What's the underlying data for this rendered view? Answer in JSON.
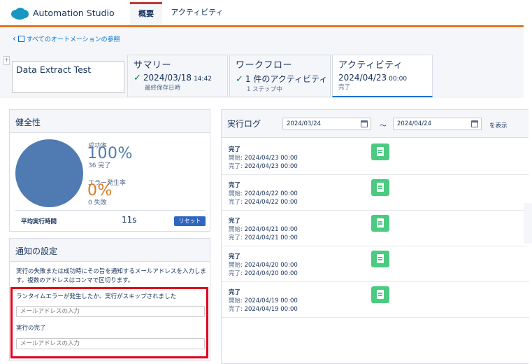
{
  "app": {
    "title": "Automation Studio"
  },
  "tabs": [
    {
      "label": "概要"
    },
    {
      "label": "アクティビティ"
    }
  ],
  "breadcrumb": {
    "label": "すべてのオートメーションの参照"
  },
  "automation": {
    "name": "Data Extract Test"
  },
  "summary_cards": {
    "summary": {
      "title": "サマリー",
      "date": "2024/03/18",
      "time": "14:42",
      "sub": "最終保存日時"
    },
    "workflow": {
      "title": "ワークフロー",
      "main": "1 件のアクティビティ",
      "sub": "1 ステップ中"
    },
    "activity": {
      "title": "アクティビティ",
      "date": "2024/04/23",
      "time": "00:00",
      "sub": "完了"
    }
  },
  "health": {
    "title": "健全性",
    "success_label": "成功率",
    "success_value": "100%",
    "success_count": "36 完了",
    "error_label": "エラー発生率",
    "error_value": "0%",
    "error_count": "0 失敗",
    "success_fraction": 1.0,
    "avg_label": "平均実行時間",
    "avg_value": "11s",
    "reset_label": "リセット"
  },
  "notify": {
    "title": "通知の設定",
    "description": "実行の失敗または成功時にその旨を通知するメールアドレスを入力します。複数のアドレスはコンマで区切ります。",
    "error_label": "ランタイムエラーが発生したか、実行がスキップされました",
    "error_placeholder": "メールアドレスの入力",
    "complete_label": "実行の完了",
    "complete_placeholder": "メールアドレスの入力"
  },
  "runlog": {
    "title": "実行ログ",
    "from_date": "2024/03/24",
    "to_date": "2024/04/24",
    "tilde": "～",
    "show_label": "を表示",
    "start_key": "開始:",
    "end_key": "完了:",
    "entries": [
      {
        "status": "完了",
        "start": "2024/04/23 00:00",
        "end": "2024/04/23 00:00"
      },
      {
        "status": "完了",
        "start": "2024/04/22 00:00",
        "end": "2024/04/22 00:00"
      },
      {
        "status": "完了",
        "start": "2024/04/21 00:00",
        "end": "2024/04/21 00:00"
      },
      {
        "status": "完了",
        "start": "2024/04/20 00:00",
        "end": "2024/04/20 00:00"
      },
      {
        "status": "完了",
        "start": "2024/04/19 00:00",
        "end": "2024/04/19 00:00"
      }
    ]
  },
  "colors": {
    "accent": "#e1781e",
    "brand_blue": "#0070d2",
    "success_green": "#4bca81",
    "highlight_red": "#e2001a"
  }
}
